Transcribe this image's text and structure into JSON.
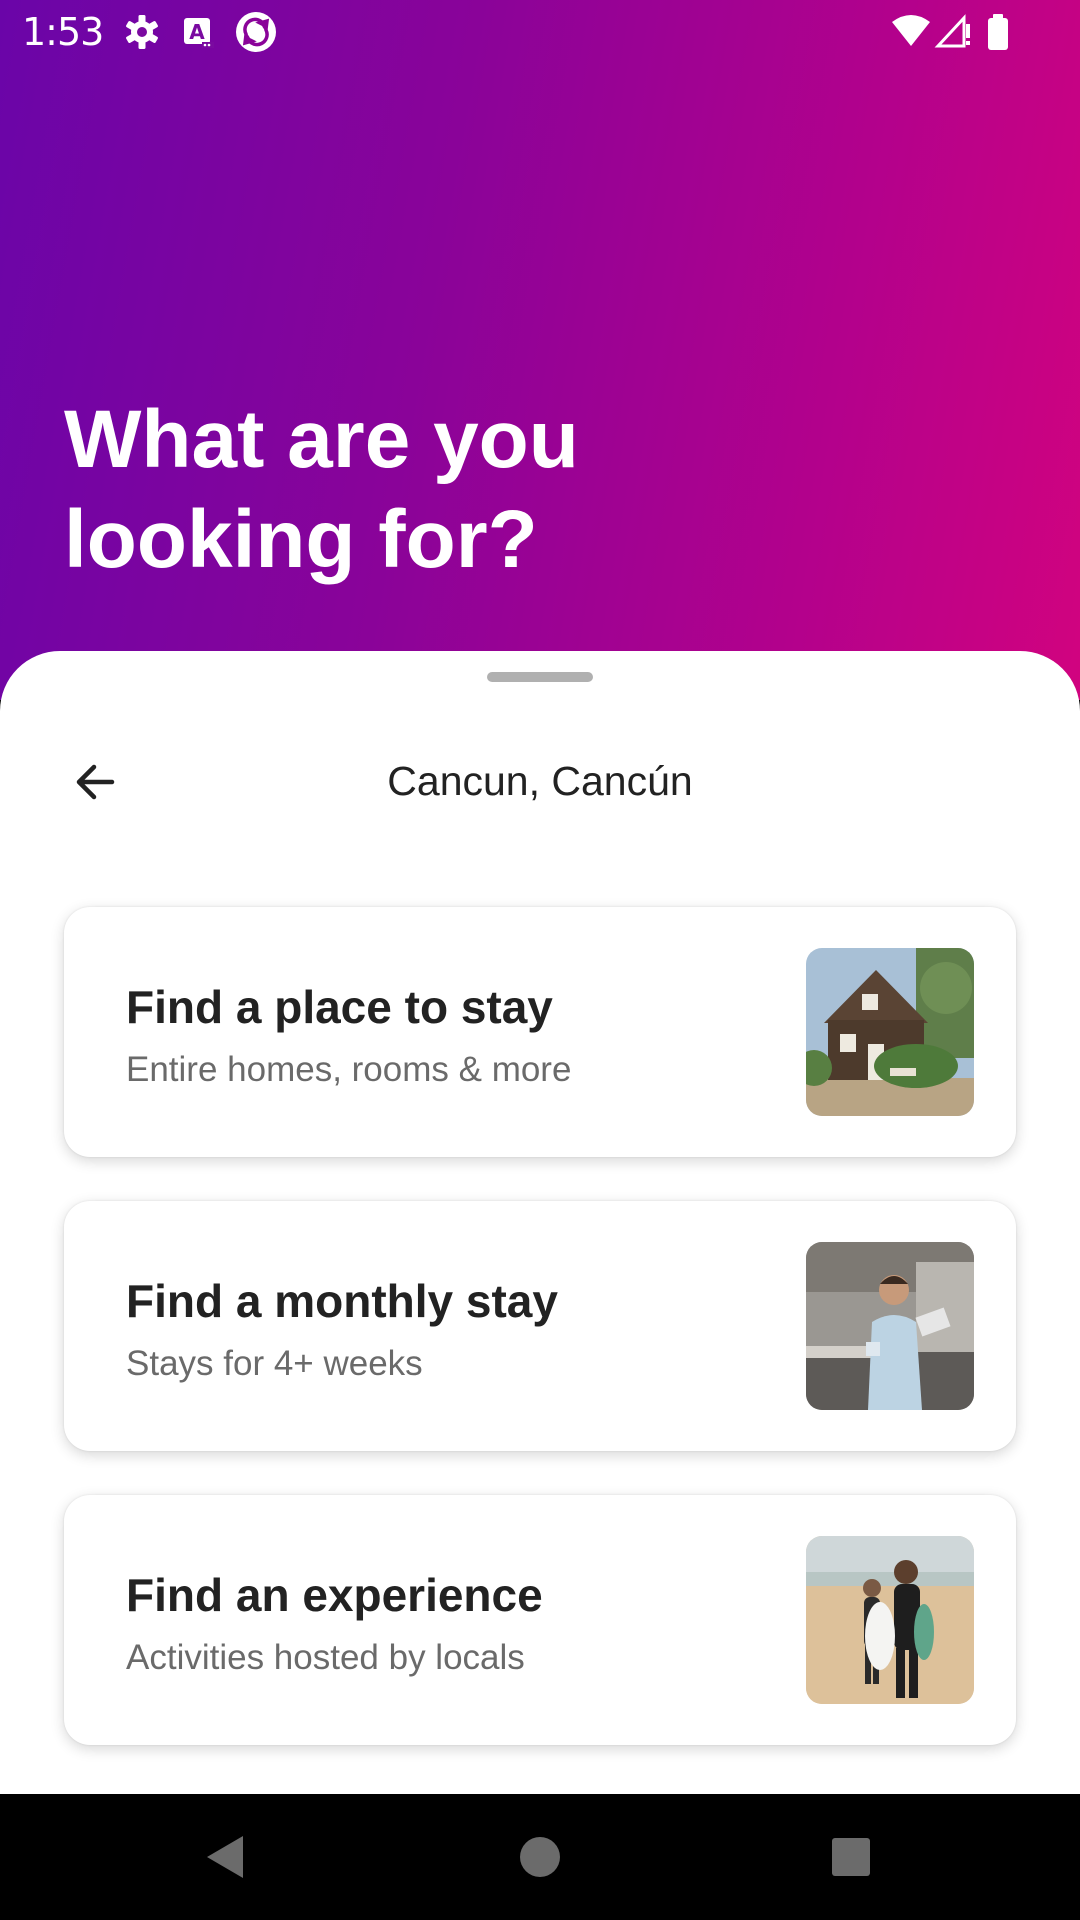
{
  "status_bar": {
    "time": "1:53",
    "left_icons": [
      "gear-icon",
      "a-notification-icon",
      "sync-icon"
    ],
    "right_icons": [
      "wifi-icon",
      "cell-signal-icon",
      "battery-icon"
    ]
  },
  "hero": {
    "title": "What are you looking for?",
    "gradient_start": "#6a05a8",
    "gradient_end": "#d1037f"
  },
  "sheet": {
    "back_icon": "arrow-left-icon",
    "location": "Cancun, Cancún",
    "cards": [
      {
        "title": "Find a place to stay",
        "subtitle": "Entire homes, rooms & more",
        "thumbnail": "house-photo"
      },
      {
        "title": "Find a monthly stay",
        "subtitle": "Stays for 4+ weeks",
        "thumbnail": "man-in-kitchen-photo"
      },
      {
        "title": "Find an experience",
        "subtitle": "Activities hosted by locals",
        "thumbnail": "surfers-on-beach-photo"
      }
    ]
  },
  "nav_bar": {
    "buttons": [
      "back-triangle-icon",
      "home-circle-icon",
      "recents-square-icon"
    ]
  }
}
